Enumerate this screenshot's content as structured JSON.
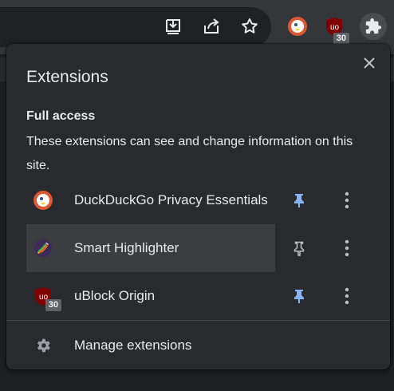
{
  "toolbar": {
    "icons": [
      {
        "name": "download-icon"
      },
      {
        "name": "share-icon"
      },
      {
        "name": "star-icon"
      },
      {
        "name": "duckduckgo-extension-icon"
      },
      {
        "name": "ublock-extension-icon",
        "badge": "30"
      },
      {
        "name": "extensions-puzzle-icon"
      }
    ],
    "ublock_badge": "30"
  },
  "popup": {
    "title": "Extensions",
    "close_icon": "close-icon",
    "section_heading": "Full access",
    "section_description": "These extensions can see and change information on this site.",
    "extensions": [
      {
        "name": "DuckDuckGo Privacy Essentials",
        "icon": "duckduckgo-icon",
        "pinned": true
      },
      {
        "name": "Smart Highlighter",
        "icon": "highlighter-icon",
        "pinned": false,
        "hovered": true
      },
      {
        "name": "uBlock Origin",
        "icon": "ublock-icon",
        "pinned": true,
        "badge": "30"
      }
    ],
    "manage_label": "Manage extensions",
    "manage_icon": "gear-icon"
  },
  "colors": {
    "pinned": "#8ab4f8",
    "unpinned": "#bdc1c6",
    "popup_bg": "#292a2d",
    "text": "#e8eaed"
  }
}
